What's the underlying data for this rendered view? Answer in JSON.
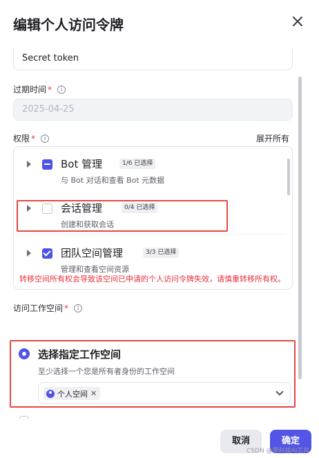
{
  "dialog": {
    "title": "编辑个人访问令牌",
    "close_icon": "close-icon"
  },
  "name_field": {
    "value": "Secret token"
  },
  "expiry": {
    "label": "过期时间",
    "required_mark": "*",
    "info_glyph": "i",
    "value": "2025-04-25"
  },
  "permissions": {
    "label": "权限",
    "required_mark": "*",
    "info_glyph": "i",
    "expand_all": "展开所有",
    "items": [
      {
        "name": "Bot 管理",
        "badge": "1/6 已选择",
        "desc": "与 Bot 对话和查看 Bot 元数据",
        "state": "partial"
      },
      {
        "name": "会话管理",
        "badge": "0/4 已选择",
        "desc": "创建和获取会话",
        "state": "none"
      },
      {
        "name": "团队空间管理",
        "badge": "3/3 已选择",
        "desc": "管理和查看空间资源",
        "state": "checked"
      }
    ]
  },
  "workspace": {
    "label": "访问工作空间",
    "required_mark": "*",
    "info_glyph": "i",
    "warning": "转移空间所有权会导致该空间已申请的个人访问令牌失效，请慎重转移所有权。",
    "option_title": "选择指定工作空间",
    "option_desc": "至少选择一个您是所有者身份的工作空间",
    "selected_tag": "个人空间",
    "tag_close": "✕"
  },
  "footer": {
    "cancel_label": "取消",
    "confirm_label": "确定"
  },
  "watermark": "CSDN @思科技AI芯片",
  "colors": {
    "accent": "#4d53e8",
    "danger": "#e5323b",
    "highlight_box": "#e0483e"
  }
}
